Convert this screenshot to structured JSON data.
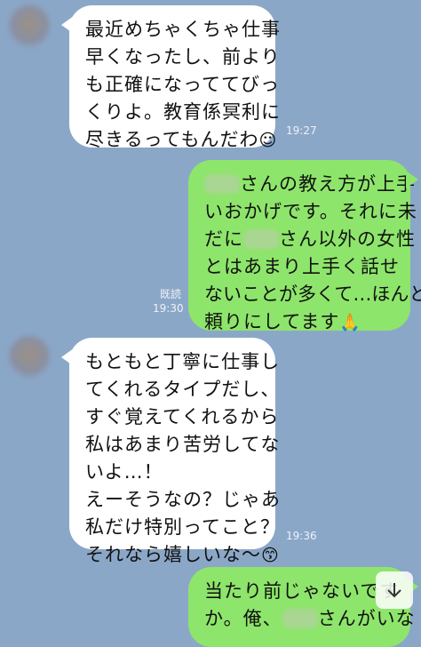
{
  "messages": {
    "m1": {
      "lines": [
        "最近めちゃくちゃ仕事",
        "早くなったし、前より",
        "も正確になっててびっ",
        "くりよ。教育係冥利に",
        "尽きるってもんだわ"
      ],
      "emoji": "☺",
      "time": "19:27"
    },
    "m2": {
      "line1_after": "さんの教え方が上手",
      "line2": "いおかげです。それに未",
      "line3_before": "だに",
      "line3_after": "さん以外の女性",
      "line4": "とはあまり上手く話せ",
      "line5": "ないことが多くて…ほんと",
      "line6": "頼りにしてます",
      "emoji": "🙏",
      "read": "既読",
      "time": "19:30"
    },
    "m3": {
      "lines": [
        "もともと丁寧に仕事し",
        "てくれるタイプだし、",
        "すぐ覚えてくれるから",
        "私はあまり苦労してな",
        "いよ…！",
        "えーそうなの？じゃあ",
        "私だけ特別ってこと？",
        "それなら嬉しいな〜"
      ],
      "emoji": "😙",
      "time": "19:36"
    },
    "m4": {
      "line1": "当たり前じゃないです",
      "line2_before": "か。俺、",
      "line2_after": "さんがいな"
    }
  },
  "icons": {
    "scroll_down": "arrow-down-icon"
  },
  "colors": {
    "background": "#8ba7c8",
    "incoming": "#ffffff",
    "outgoing": "#8ee56b"
  }
}
